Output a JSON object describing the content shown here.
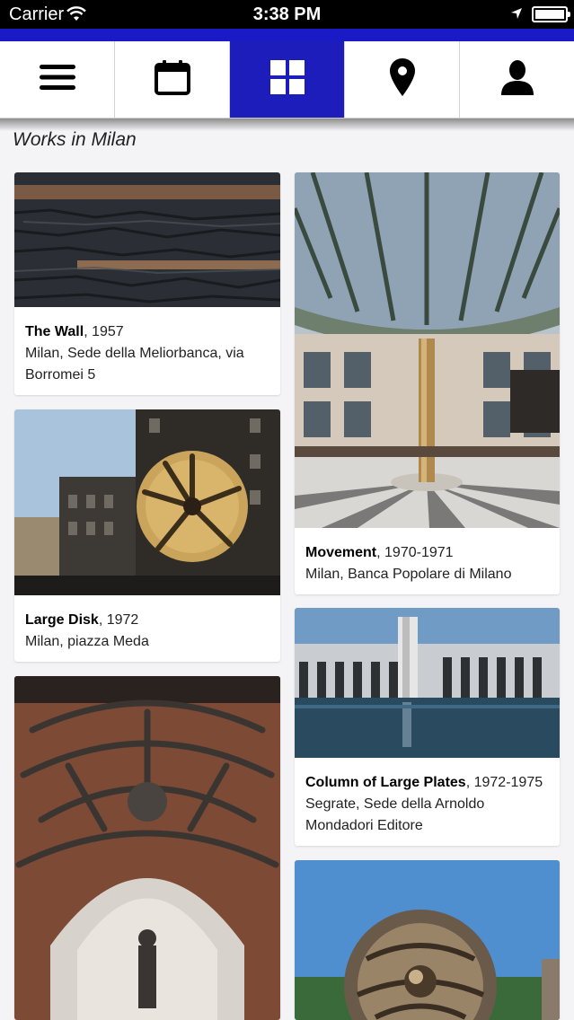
{
  "status_bar": {
    "carrier": "Carrier",
    "time": "3:38 PM"
  },
  "colors": {
    "accent": "#1a1ac6",
    "active_tab": "#1d1dbc"
  },
  "nav": {
    "tabs": [
      {
        "icon": "menu-icon",
        "active": false
      },
      {
        "icon": "calendar-icon",
        "active": false
      },
      {
        "icon": "grid-icon",
        "active": true
      },
      {
        "icon": "map-pin-icon",
        "active": false
      },
      {
        "icon": "user-icon",
        "active": false
      }
    ]
  },
  "page": {
    "title": "Works in Milan"
  },
  "works": [
    {
      "title": "The Wall",
      "year": ", 1957",
      "location": "Milan, Sede della Meliorbanca, via Borromei 5"
    },
    {
      "title": "Large Disk",
      "year": ", 1972",
      "location": "Milan, piazza Meda"
    },
    {
      "title": "Movement",
      "year": ", 1970-1971",
      "location": "Milan, Banca Popolare di Milano"
    },
    {
      "title": "Column of Large Plates",
      "year": ", 1972-1975",
      "location": "Segrate, Sede della Arnoldo Mondadori Editore"
    }
  ]
}
